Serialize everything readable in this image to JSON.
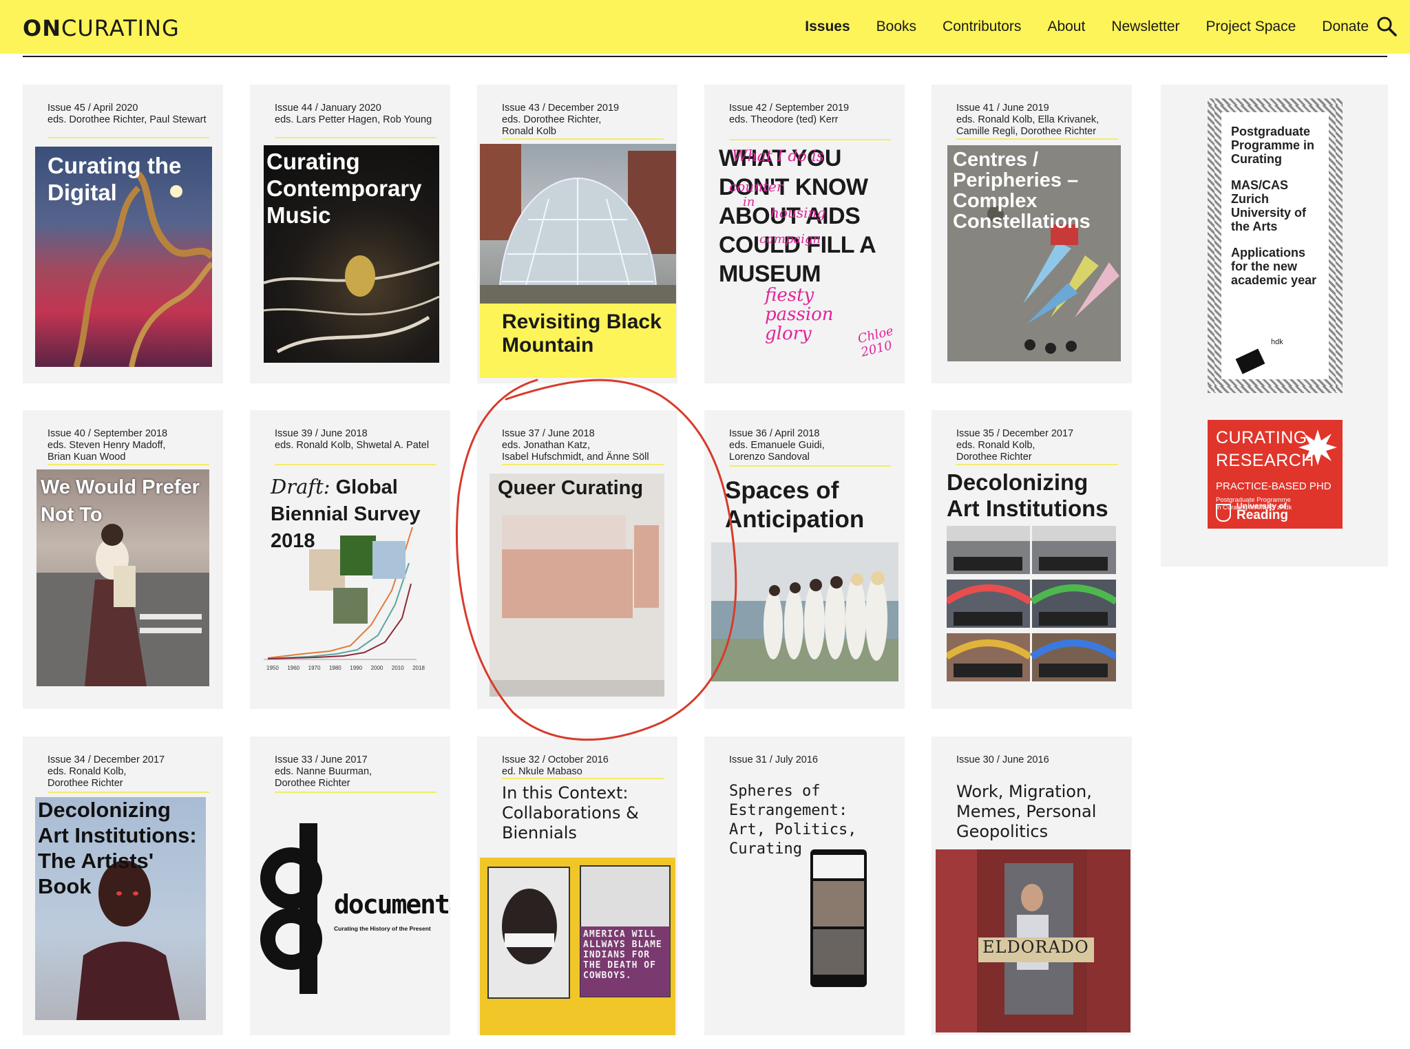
{
  "header": {
    "logo_bold": "ON",
    "logo_light": "CURATING",
    "nav": [
      "Issues",
      "Books",
      "Contributors",
      "About",
      "Newsletter",
      "Project Space",
      "Donate"
    ],
    "active_nav": "Issues",
    "search_icon": "search-icon"
  },
  "issues": [
    {
      "meta1": "Issue 45 / April 2020",
      "meta2": "eds. Dorothee Richter, Paul Stewart",
      "meta3": "",
      "cover_title": "Curating the Digital"
    },
    {
      "meta1": "Issue 44 / January 2020",
      "meta2": "eds. Lars Petter Hagen, Rob Young",
      "meta3": "",
      "cover_title": "Curating Contemporary Music"
    },
    {
      "meta1": "Issue 43 / December 2019",
      "meta2": "eds. Dorothee Richter,",
      "meta3": "Ronald Kolb",
      "cover_title": "Revisiting Black Mountain"
    },
    {
      "meta1": "Issue 42 / September 2019",
      "meta2": "eds. Theodore (ted) Kerr",
      "meta3": "",
      "cover_title": "WHAT YOU DON'T KNOW ABOUT AIDS COULD FILL A MUSEUM"
    },
    {
      "meta1": "Issue 41 / June 2019",
      "meta2": "eds. Ronald Kolb, Ella Krivanek,",
      "meta3": "Camille Regli, Dorothee Richter",
      "cover_title": "Centres / Peripheries – Complex Constellations"
    },
    {
      "meta1": "Issue 40 / September 2018",
      "meta2": "eds. Steven Henry Madoff,",
      "meta3": "Brian Kuan Wood",
      "cover_title": "We Would Prefer Not To"
    },
    {
      "meta1": "Issue 39 / June 2018",
      "meta2": "eds. Ronald Kolb, Shwetal A. Patel",
      "meta3": "",
      "cover_title_italic": "Draft:",
      "cover_title": "Global Biennial Survey 2018"
    },
    {
      "meta1": "Issue 37 / June 2018",
      "meta2": "eds. Jonathan Katz,",
      "meta3": "Isabel Hufschmidt, and Änne Söll",
      "cover_title": "Queer Curating"
    },
    {
      "meta1": "Issue 36 / April 2018",
      "meta2": "eds. Emanuele Guidi,",
      "meta3": "Lorenzo Sandoval",
      "cover_title": "Spaces of Anticipation"
    },
    {
      "meta1": "Issue 35 / December 2017",
      "meta2": "eds. Ronald Kolb,",
      "meta3": "Dorothee Richter",
      "cover_title": "Decolonizing Art Institutions"
    },
    {
      "meta1": "Issue 34 / December 2017",
      "meta2": "eds. Ronald Kolb,",
      "meta3": "Dorothee Richter",
      "cover_title": "Decolonizing Art Institutions: The Artists' Book"
    },
    {
      "meta1": "Issue 33 / June 2017",
      "meta2": "eds. Nanne Buurman,",
      "meta3": "Dorothee Richter",
      "cover_title": "documenta",
      "cover_sub": "Curating the History of the Present"
    },
    {
      "meta1": "Issue 32 / October 2016",
      "meta2": "ed. Nkule Mabaso",
      "meta3": "",
      "cover_title": "In this Context: Collaborations & Biennials",
      "sign_text": "AMERICA WILL ALLWAYS BLAME INDIANS FOR THE DEATH OF COWBOYS."
    },
    {
      "meta1": "Issue 31 / July 2016",
      "meta2": "",
      "meta3": "",
      "cover_title": "Spheres of Estrangement: Art, Politics, Curating"
    },
    {
      "meta1": "Issue 30 / June 2016",
      "meta2": "",
      "meta3": "",
      "cover_title": "Work, Migration, Memes, Personal Geopolitics",
      "sign_text": "ELDORADO"
    }
  ],
  "cover_handwriting": [
    "What I do is",
    "counter",
    "in",
    "housing",
    "campaign",
    "fiesty",
    "passion",
    "glory",
    "Chloe",
    "2010"
  ],
  "graph_years": [
    "1950",
    "1960",
    "1970",
    "1980",
    "1990",
    "2000",
    "2010",
    "2018"
  ],
  "sidebar": {
    "ad1": {
      "p1": "Postgraduate Programme in Curating",
      "p2": "MAS/CAS Zurich University of the Arts",
      "p3": "Applications for the new academic year",
      "logo": "hdk"
    },
    "ad2": {
      "l1": "CURATING",
      "l2": "RESEARCH",
      "l3": "PRACTICE-BASED PHD",
      "l4": "Postgraduate Programme",
      "l5": "in Curating MA/MAS zHdk",
      "l6": "University of",
      "l7": "Reading"
    }
  },
  "colors": {
    "brand_yellow": "#fcf459",
    "card_bg": "#f3f3f3",
    "annotation_red": "#d83a2a",
    "ad_red": "#e0352b"
  }
}
